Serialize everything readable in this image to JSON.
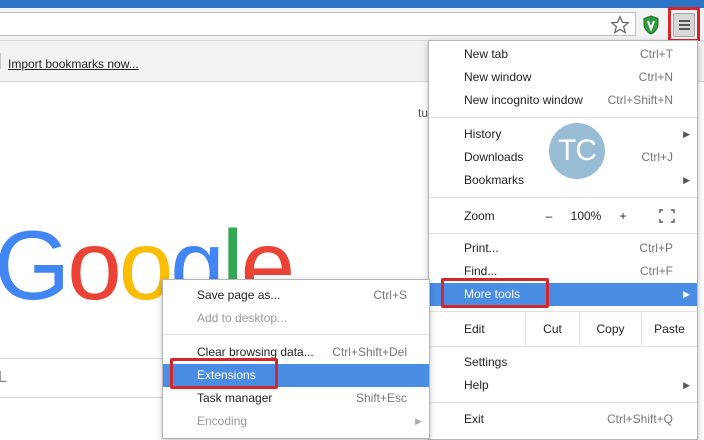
{
  "browser": {
    "bookmark_link": "Import bookmarks now...",
    "partial_edge_text": "tu",
    "google_logo": [
      "G",
      "o",
      "o",
      "g",
      "l",
      "e"
    ],
    "search_partial_text": "L",
    "icons": {
      "star": "star-icon",
      "shield": "shield-icon",
      "menu": "hamburger-menu-icon"
    }
  },
  "menu": {
    "items": [
      {
        "label": "New tab",
        "shortcut": "Ctrl+T"
      },
      {
        "label": "New window",
        "shortcut": "Ctrl+N"
      },
      {
        "label": "New incognito window",
        "shortcut": "Ctrl+Shift+N"
      },
      {
        "label": "History",
        "shortcut": ""
      },
      {
        "label": "Downloads",
        "shortcut": "Ctrl+J"
      },
      {
        "label": "Bookmarks",
        "shortcut": ""
      },
      {
        "label": "Print...",
        "shortcut": "Ctrl+P"
      },
      {
        "label": "Find...",
        "shortcut": "Ctrl+F"
      },
      {
        "label": "More tools",
        "shortcut": ""
      },
      {
        "label": "Settings",
        "shortcut": ""
      },
      {
        "label": "Help",
        "shortcut": ""
      },
      {
        "label": "Exit",
        "shortcut": "Ctrl+Shift+Q"
      }
    ],
    "zoom": {
      "label": "Zoom",
      "minus": "–",
      "value": "100%",
      "plus": "+"
    },
    "edit": {
      "label": "Edit",
      "cut": "Cut",
      "copy": "Copy",
      "paste": "Paste"
    },
    "watermark": "TC"
  },
  "submenu": {
    "items": [
      {
        "label": "Save page as...",
        "shortcut": "Ctrl+S"
      },
      {
        "label": "Add to desktop...",
        "shortcut": ""
      },
      {
        "label": "Clear browsing data...",
        "shortcut": "Ctrl+Shift+Del"
      },
      {
        "label": "Extensions",
        "shortcut": ""
      },
      {
        "label": "Task manager",
        "shortcut": "Shift+Esc"
      },
      {
        "label": "Encoding",
        "shortcut": ""
      }
    ]
  },
  "colors": {
    "highlight_box": "#d6262b",
    "menu_active": "#4a8de5",
    "title_bar": "#2b74c6"
  }
}
